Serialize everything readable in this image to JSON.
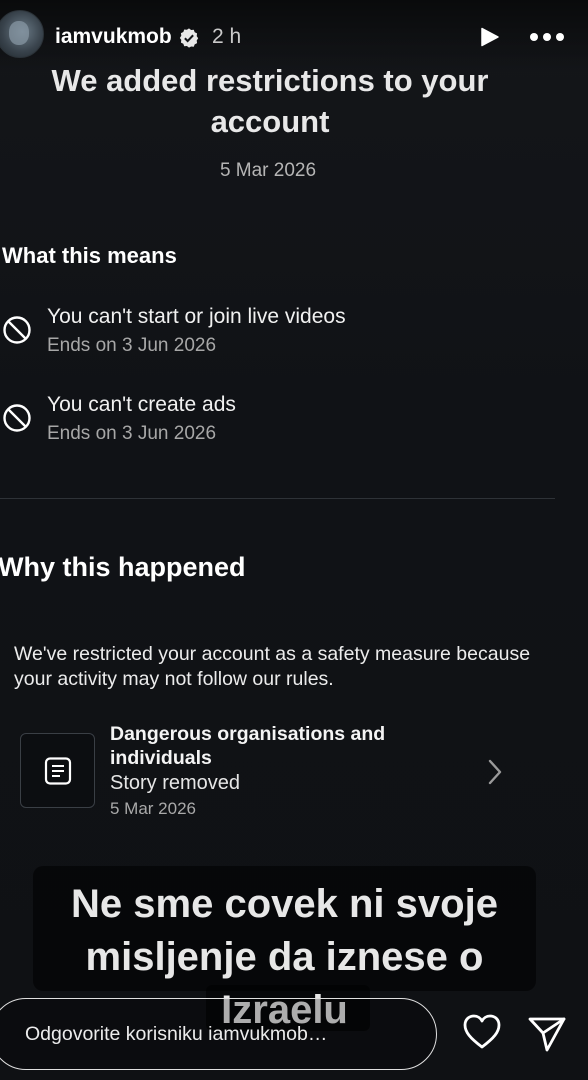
{
  "story_header": {
    "username": "iamvukmob",
    "time_ago": "2 h",
    "avatar_icon": "profile-avatar",
    "verified_icon": "verified-badge-icon",
    "play_icon": "play-icon",
    "more_icon": "more-horizontal-icon"
  },
  "notice": {
    "title": "We added restrictions to your account",
    "date": "5 Mar 2026",
    "what_heading": "What this means",
    "restrictions": [
      {
        "icon": "prohibited-icon",
        "title": "You can't start or join live videos",
        "sub": "Ends on 3 Jun 2026"
      },
      {
        "icon": "prohibited-icon",
        "title": "You can't create ads",
        "sub": "Ends on 3 Jun 2026"
      }
    ],
    "why_heading": "Why this happened",
    "why_text": "We've restricted your account as a safety measure because your activity may not follow our rules.",
    "violation": {
      "icon": "document-icon",
      "title": "Dangerous organisations and individuals",
      "status": "Story removed",
      "date": "5 Mar 2026"
    }
  },
  "caption": {
    "line1": "Ne sme covek ni svoje",
    "line2": "misljenje da iznese o",
    "line3": "Izraelu"
  },
  "reply_bar": {
    "placeholder": "Odgovorite korisniku iamvukmob…",
    "heart_icon": "heart-icon",
    "send_icon": "send-icon"
  },
  "colors": {
    "background": "#0f1114",
    "text_primary": "#ffffff",
    "text_secondary": "#a7a7a7",
    "divider": "#2e3237"
  }
}
